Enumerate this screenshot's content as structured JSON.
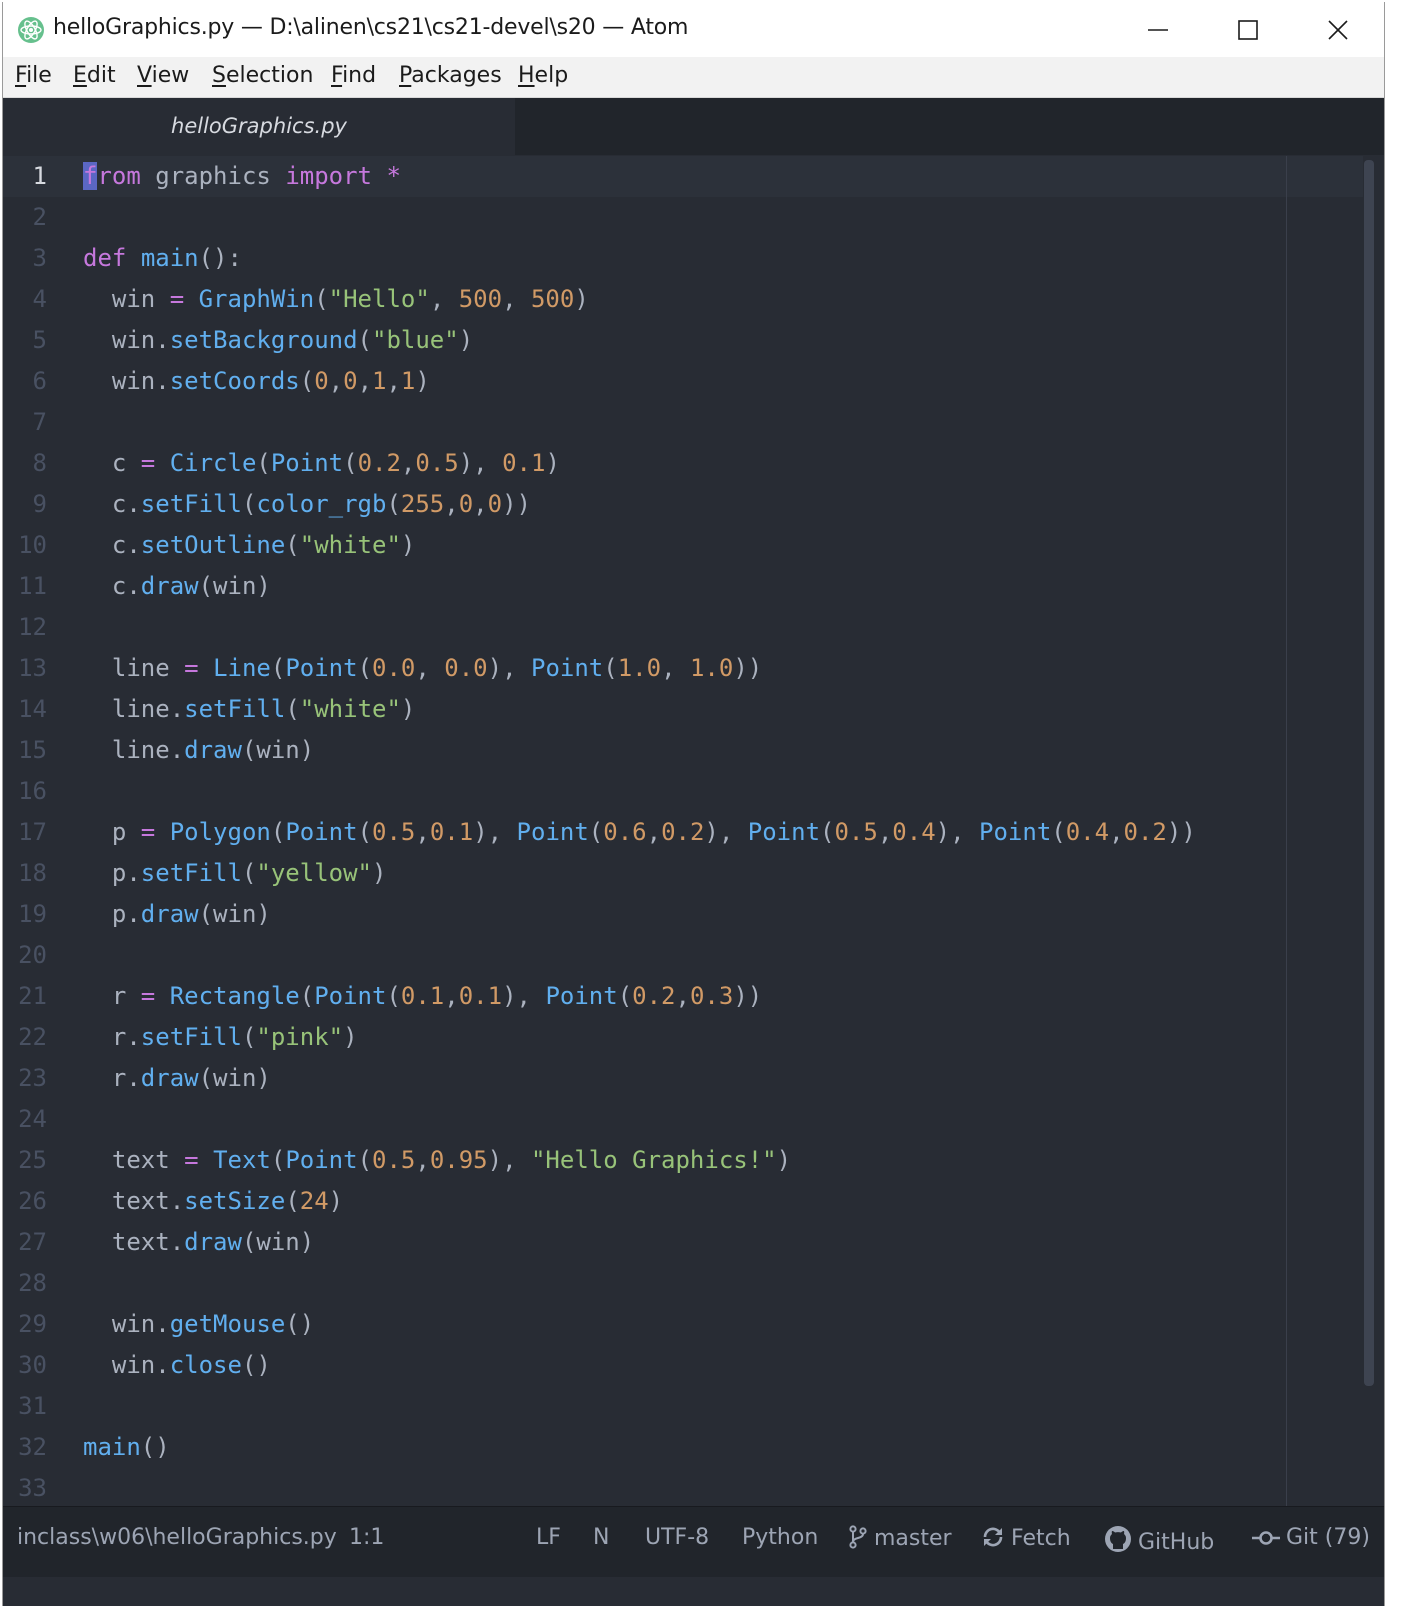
{
  "window": {
    "title": "helloGraphics.py — D:\\alinen\\cs21\\cs21-devel\\s20 — Atom"
  },
  "menu": [
    {
      "underline": "F",
      "rest": "ile"
    },
    {
      "underline": "E",
      "rest": "dit"
    },
    {
      "underline": "V",
      "rest": "iew"
    },
    {
      "underline": "S",
      "rest": "election"
    },
    {
      "underline": "F",
      "rest": "ind"
    },
    {
      "underline": "P",
      "rest": "ackages"
    },
    {
      "underline": "H",
      "rest": "elp"
    }
  ],
  "tab": {
    "label": "helloGraphics.py"
  },
  "editor": {
    "language": "Python",
    "cursor_line": 1,
    "line_numbers": [
      "1",
      "2",
      "3",
      "4",
      "5",
      "6",
      "7",
      "8",
      "9",
      "10",
      "11",
      "12",
      "13",
      "14",
      "15",
      "16",
      "17",
      "18",
      "19",
      "20",
      "21",
      "22",
      "23",
      "24",
      "25",
      "26",
      "27",
      "28",
      "29",
      "30",
      "31",
      "32",
      "33"
    ],
    "lines": [
      "from graphics import *",
      "",
      "def main():",
      "  win = GraphWin(\"Hello\", 500, 500)",
      "  win.setBackground(\"blue\")",
      "  win.setCoords(0,0,1,1)",
      "",
      "  c = Circle(Point(0.2,0.5), 0.1)",
      "  c.setFill(color_rgb(255,0,0))",
      "  c.setOutline(\"white\")",
      "  c.draw(win)",
      "",
      "  line = Line(Point(0.0, 0.0), Point(1.0, 1.0))",
      "  line.setFill(\"white\")",
      "  line.draw(win)",
      "",
      "  p = Polygon(Point(0.5,0.1), Point(0.6,0.2), Point(0.5,0.4), Point(0.4,0.2))",
      "  p.setFill(\"yellow\")",
      "  p.draw(win)",
      "",
      "  r = Rectangle(Point(0.1,0.1), Point(0.2,0.3))",
      "  r.setFill(\"pink\")",
      "  r.draw(win)",
      "",
      "  text = Text(Point(0.5,0.95), \"Hello Graphics!\")",
      "  text.setSize(24)",
      "  text.draw(win)",
      "",
      "  win.getMouse()",
      "  win.close()",
      "",
      "main()",
      ""
    ]
  },
  "status": {
    "path": "inclass\\w06\\helloGraphics.py",
    "position": "1:1",
    "line_ending": "LF",
    "indent_mode": "N",
    "encoding": "UTF-8",
    "grammar": "Python",
    "branch": "master",
    "fetch": "Fetch",
    "github": "GitHub",
    "git": "Git (79)"
  },
  "colors": {
    "background": "#282c34",
    "keyword": "#c678dd",
    "function": "#61afef",
    "string": "#98c379",
    "number": "#d19a66",
    "text": "#abb2bf"
  }
}
